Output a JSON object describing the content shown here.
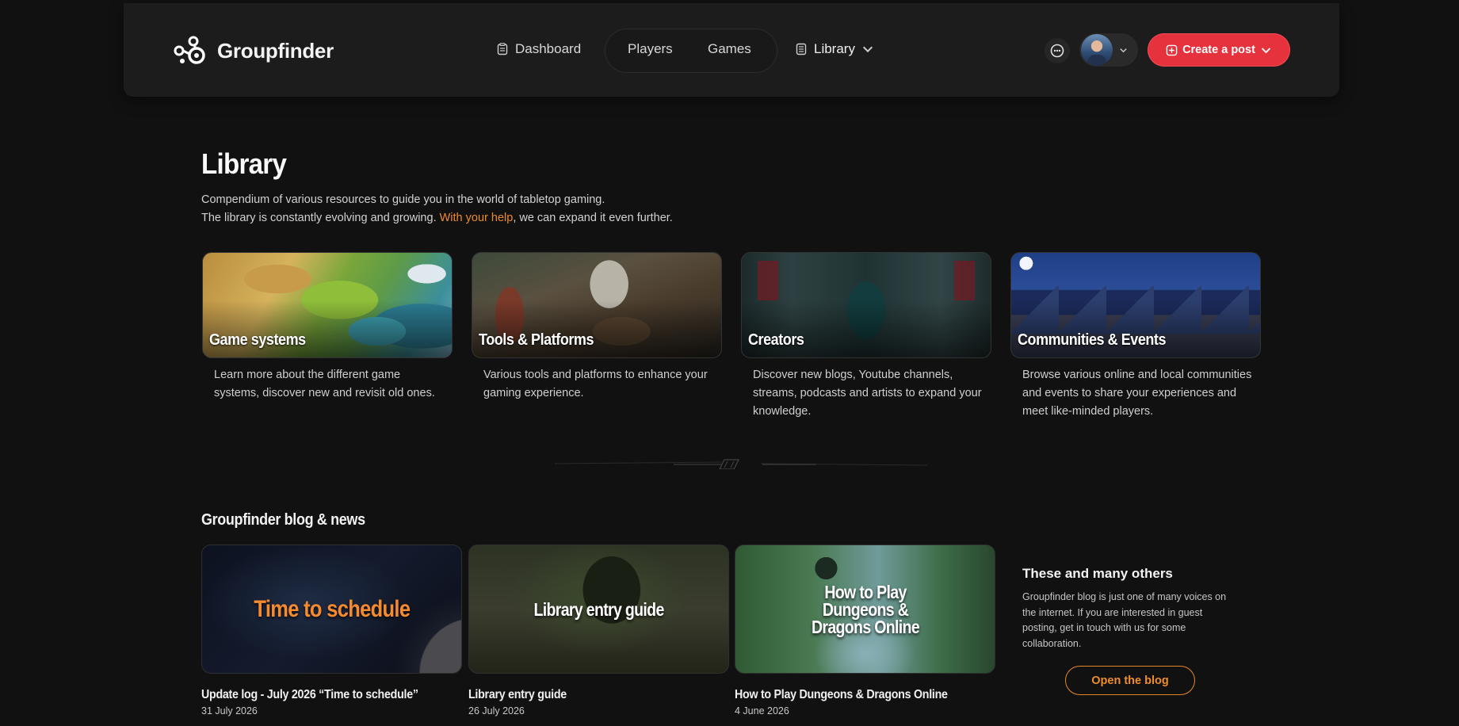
{
  "header": {
    "brand": "Groupfinder",
    "nav": {
      "dashboard": "Dashboard",
      "players": "Players",
      "games": "Games",
      "library": "Library"
    },
    "create_post": "Create a post"
  },
  "library": {
    "title": "Library",
    "intro_line1": "Compendium of various resources to guide you in the world of tabletop gaming.",
    "intro_line2_pre": "The library is constantly evolving and growing. ",
    "intro_link": "With your help",
    "intro_line2_post": ", we can expand it even further.",
    "cards": [
      {
        "title": "Game systems",
        "desc": "Learn more about the different game systems, discover new and revisit old ones."
      },
      {
        "title": "Tools & Platforms",
        "desc": "Various tools and platforms to enhance your gaming experience."
      },
      {
        "title": "Creators",
        "desc": "Discover new blogs, Youtube channels, streams, podcasts and artists to expand your knowledge."
      },
      {
        "title": "Communities & Events",
        "desc": "Browse various online and local communities and events to share your experiences and meet like-minded players."
      }
    ]
  },
  "blog": {
    "title": "Groupfinder blog & news",
    "posts": [
      {
        "image_text": "Time to schedule",
        "name": "Update log - July 2026 “Time to schedule”",
        "date": "31 July 2026"
      },
      {
        "image_text": "Library entry guide",
        "name": "Library entry guide",
        "date": "26 July 2026"
      },
      {
        "image_text": "How to Play Dungeons & Dragons Online",
        "name": "How to Play Dungeons & Dragons Online",
        "date": "4 June 2026"
      }
    ],
    "others": {
      "title": "These and many others",
      "text": "Groupfinder blog is just one of many voices on the internet. If you are interested in guest posting, get in touch with us for some collaboration.",
      "button": "Open the blog"
    }
  },
  "colors": {
    "accent_orange": "#ef8a2b",
    "primary_red": "#e5323c",
    "background": "#111111"
  },
  "icons": [
    "groupfinder-logo-icon",
    "dashboard-icon",
    "library-icon",
    "chat-icon",
    "chevron-down-icon",
    "plus-square-icon"
  ]
}
